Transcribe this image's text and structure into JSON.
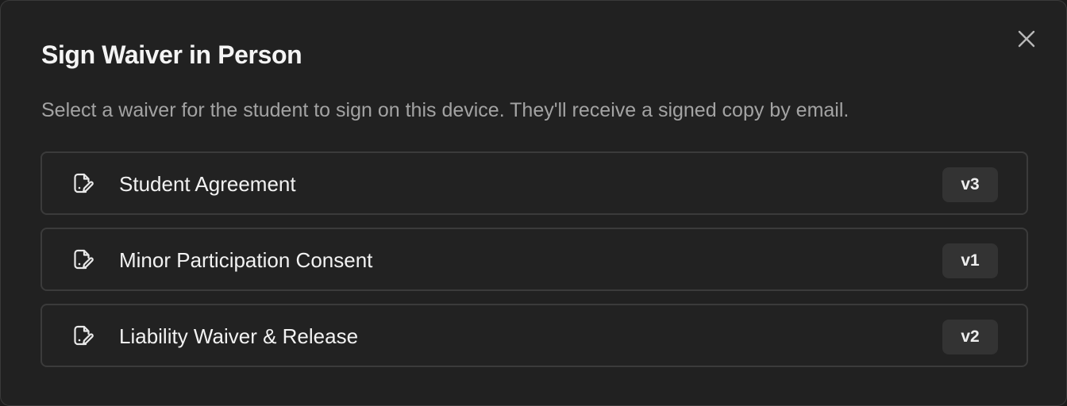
{
  "dialog": {
    "title": "Sign Waiver in Person",
    "description": "Select a waiver for the student to sign on this device. They'll receive a signed copy by email.",
    "close_icon": "close-icon"
  },
  "waivers": [
    {
      "name": "Student Agreement",
      "version": "v3",
      "icon": "document-signature-icon"
    },
    {
      "name": "Minor Participation Consent",
      "version": "v1",
      "icon": "document-signature-icon"
    },
    {
      "name": "Liability Waiver & Release",
      "version": "v2",
      "icon": "document-signature-icon"
    }
  ],
  "colors": {
    "background": "#212121",
    "border": "#3b3b3b",
    "text": "#f2f2f2",
    "muted_text": "#a3a3a3",
    "badge_background": "#333333"
  }
}
